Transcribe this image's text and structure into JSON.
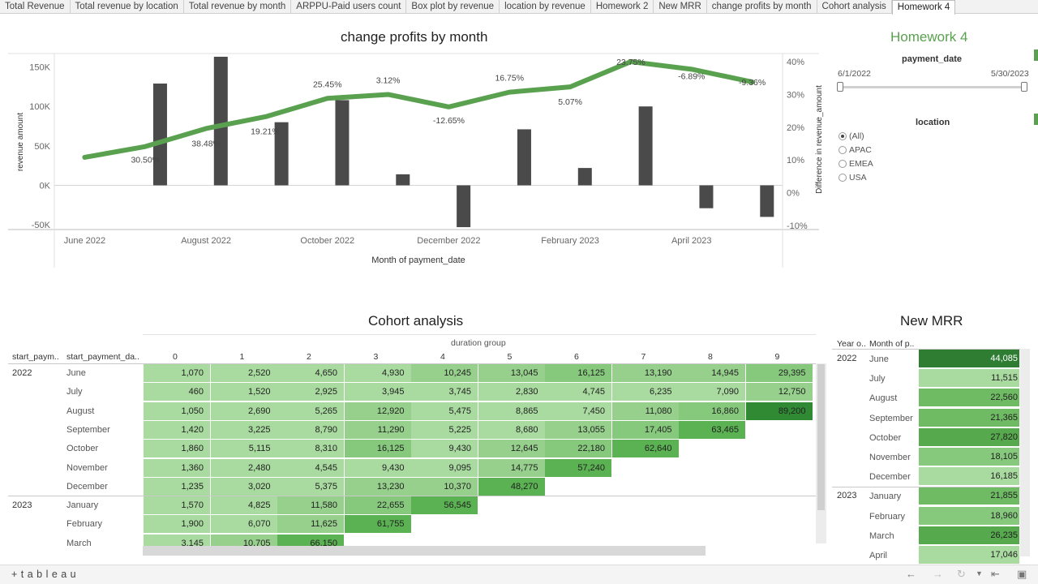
{
  "tabs": [
    "Total Revenue",
    "Total revenue by location",
    "Total revenue by month",
    "ARPPU-Paid users count",
    "Box plot by revenue",
    "location by revenue",
    "Homework 2",
    "New MRR",
    "change profits by month",
    "Cohort analysis",
    "Homework 4"
  ],
  "active_tab": "Homework 4",
  "dashboard_title": "Homework 4",
  "filters": {
    "payment_date": {
      "label": "payment_date",
      "start": "6/1/2022",
      "end": "5/30/2023"
    },
    "location": {
      "label": "location",
      "options": [
        "(All)",
        "APAC",
        "EMEA",
        "USA"
      ],
      "selected": "(All)"
    }
  },
  "chart_data": {
    "type": "bar",
    "title": "change profits by month",
    "xlabel": "Month of payment_date",
    "ylabel": "revenue amount",
    "y2label": "Difference in revenue_amount",
    "x_tick_labels": [
      "June 2022",
      "August 2022",
      "October 2022",
      "December 2022",
      "February 2023",
      "April 2023"
    ],
    "y_ticks": [
      "150K",
      "100K",
      "50K",
      "0K",
      "-50K"
    ],
    "y2_ticks": [
      "40%",
      "30%",
      "20%",
      "10%",
      "0%",
      "-10%"
    ],
    "ylim": [
      -55000,
      165000
    ],
    "y2lim": [
      -11,
      42
    ],
    "categories": [
      "Jun 2022",
      "Jul 2022",
      "Aug 2022",
      "Sep 2022",
      "Oct 2022",
      "Nov 2022",
      "Dec 2022",
      "Jan 2023",
      "Feb 2023",
      "Mar 2023",
      "Apr 2023",
      "May 2023"
    ],
    "bar_values": [
      null,
      129000,
      163000,
      80000,
      108000,
      14000,
      -53000,
      71000,
      22000,
      100000,
      -29000,
      -40000
    ],
    "line_values": [
      10.8,
      14.1,
      19.6,
      23.3,
      28.8,
      30.0,
      26.2,
      30.7,
      32.3,
      40.0,
      37.7,
      33.8
    ],
    "line_labels": [
      "",
      "30.50%",
      "38.48%",
      "19.21%",
      "25.45%",
      "3.12%",
      "-12.65%",
      "16.75%",
      "5.07%",
      "23.75%",
      "-6.89%",
      "-9.36%"
    ],
    "bar_color": "#4a4a4a",
    "line_color": "#59a14f"
  },
  "cohort": {
    "title": "Cohort analysis",
    "col_header": "duration group",
    "row_headers": [
      "start_paym..",
      "start_payment_da.."
    ],
    "columns": [
      "0",
      "1",
      "2",
      "3",
      "4",
      "5",
      "6",
      "7",
      "8",
      "9"
    ],
    "years": [
      {
        "label": "2022",
        "row": 0
      },
      {
        "label": "2023",
        "row": 7
      }
    ],
    "rows": [
      {
        "month": "June",
        "values": [
          "1,070",
          "2,520",
          "4,650",
          "4,930",
          "10,245",
          "13,045",
          "16,125",
          "13,190",
          "14,945",
          "29,395"
        ]
      },
      {
        "month": "July",
        "values": [
          "460",
          "1,520",
          "2,925",
          "3,945",
          "3,745",
          "2,830",
          "4,745",
          "6,235",
          "7,090",
          "12,750"
        ]
      },
      {
        "month": "August",
        "values": [
          "1,050",
          "2,690",
          "5,265",
          "12,920",
          "5,475",
          "8,865",
          "7,450",
          "11,080",
          "16,860",
          "89,200"
        ]
      },
      {
        "month": "September",
        "values": [
          "1,420",
          "3,225",
          "8,790",
          "11,290",
          "5,225",
          "8,680",
          "13,055",
          "17,405",
          "63,465"
        ]
      },
      {
        "month": "October",
        "values": [
          "1,860",
          "5,115",
          "8,310",
          "16,125",
          "9,430",
          "12,645",
          "22,180",
          "62,640"
        ]
      },
      {
        "month": "November",
        "values": [
          "1,360",
          "2,480",
          "4,545",
          "9,430",
          "9,095",
          "14,775",
          "57,240"
        ]
      },
      {
        "month": "December",
        "values": [
          "1,235",
          "3,020",
          "5,375",
          "13,230",
          "10,370",
          "48,270"
        ]
      },
      {
        "month": "January",
        "values": [
          "1,570",
          "4,825",
          "11,580",
          "22,655",
          "56,545"
        ]
      },
      {
        "month": "February",
        "values": [
          "1,900",
          "6,070",
          "11,625",
          "61,755"
        ]
      },
      {
        "month": "March",
        "values": [
          "3,145",
          "10,705",
          "66,150"
        ]
      }
    ]
  },
  "mrr": {
    "title": "New MRR",
    "headers": [
      "Year o..",
      "Month of p.."
    ],
    "rows": [
      {
        "year": "2022",
        "month": "June",
        "value": "44,085"
      },
      {
        "year": "",
        "month": "July",
        "value": "11,515"
      },
      {
        "year": "",
        "month": "August",
        "value": "22,560"
      },
      {
        "year": "",
        "month": "September",
        "value": "21,365"
      },
      {
        "year": "",
        "month": "October",
        "value": "27,820"
      },
      {
        "year": "",
        "month": "November",
        "value": "18,105"
      },
      {
        "year": "",
        "month": "December",
        "value": "16,185"
      },
      {
        "year": "2023",
        "month": "January",
        "value": "21,855"
      },
      {
        "year": "",
        "month": "February",
        "value": "18,960"
      },
      {
        "year": "",
        "month": "March",
        "value": "26,235"
      },
      {
        "year": "",
        "month": "April",
        "value": "17,046"
      }
    ]
  },
  "footer": {
    "logo": "+ t a b l e a u"
  }
}
